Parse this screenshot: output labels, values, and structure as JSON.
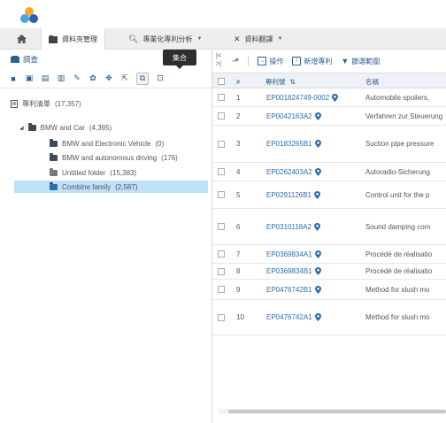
{
  "nav": {
    "tabs": [
      {
        "label": "資料夾管理",
        "active": true
      },
      {
        "label": "專業化專利分析",
        "active": false
      },
      {
        "label": "資料翻譯",
        "active": false
      }
    ]
  },
  "left_panel": {
    "header": "調查",
    "tooltip": "集合",
    "tree": {
      "root_label": "專利清單",
      "root_count": "(17,357)",
      "items": [
        {
          "label": "BMW and Car",
          "count": "(4,395)",
          "level": 1
        },
        {
          "label": "BMW and Electronic Vehicle",
          "count": "(0)",
          "level": 2
        },
        {
          "label": "BMW and autonomous driving",
          "count": "(176)",
          "level": 2
        },
        {
          "label": "Untitled folder",
          "count": "(15,383)",
          "level": 2
        },
        {
          "label": "Combine family",
          "count": "(2,587)",
          "level": 2,
          "selected": true
        }
      ]
    }
  },
  "toolbar": {
    "sort_label": "操作",
    "add_label": "新增專利",
    "filter_label": "篩選範圍"
  },
  "table": {
    "headers": {
      "num": "#",
      "patent_no": "專利號",
      "title": "名稱"
    },
    "rows": [
      {
        "num": "1",
        "patent_no": "EP001824749-0002",
        "title": "Automobile spoilers,"
      },
      {
        "num": "2",
        "patent_no": "EP0042163A2",
        "title": "Verfahren zur Steuerung"
      },
      {
        "num": "3",
        "patent_no": "EP0183265B1",
        "title": "Suction pipe pressure"
      },
      {
        "num": "4",
        "patent_no": "EP0262403A2",
        "title": "Autoradio-Sicherung"
      },
      {
        "num": "5",
        "patent_no": "EP0291126B1",
        "title": "Control unit for the p"
      },
      {
        "num": "6",
        "patent_no": "EP0310118A2",
        "title": "Sound damping com"
      },
      {
        "num": "7",
        "patent_no": "EP0369834A1",
        "title": "Procédé de réalisatio"
      },
      {
        "num": "8",
        "patent_no": "EP0369834B1",
        "title": "Procédé de réalisatio"
      },
      {
        "num": "9",
        "patent_no": "EP0476742B1",
        "title": "Method for slush mo"
      },
      {
        "num": "10",
        "patent_no": "EP0476742A1",
        "title": "Method for slush mo"
      }
    ]
  }
}
